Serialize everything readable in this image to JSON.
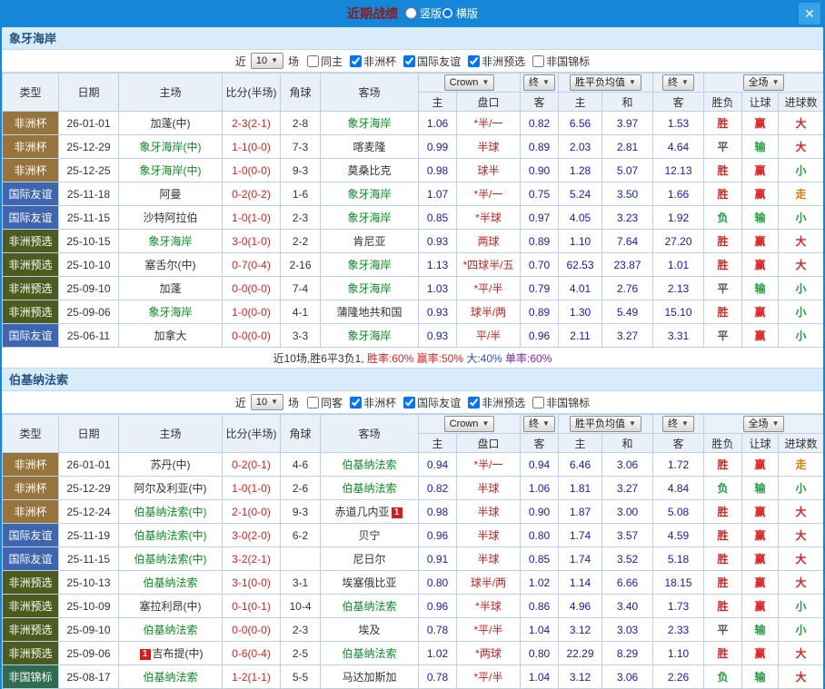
{
  "titlebar": {
    "title": "近期战绩",
    "layout_options": [
      {
        "label": "竖版",
        "selected": false
      },
      {
        "label": "横版",
        "selected": true
      }
    ],
    "close_label": "✕"
  },
  "columns": {
    "type": "类型",
    "date": "日期",
    "home": "主场",
    "score": "比分(半场)",
    "corner": "角球",
    "away": "客场",
    "odds_company": "Crown",
    "final1": "终",
    "wdl_avg": "胜平负均值",
    "final2": "终",
    "fulltime": "全场",
    "sub": [
      "主",
      "盘口",
      "客",
      "主",
      "和",
      "客",
      "胜负",
      "让球",
      "进球数"
    ]
  },
  "colors": {
    "type_非洲杯": "#96743C",
    "type_国际友谊": "#3E65B0",
    "type_非洲预选": "#4D5C1E",
    "type_非国锦标": "#2F6B50",
    "win": "#E02222",
    "draw": "#555555",
    "loss": "#1FA03C",
    "handicap_win": "#E02222",
    "handicap_loss": "#1FA03C",
    "push": "#E07A00",
    "big": "#E02222",
    "small": "#1FA03C",
    "focus_team": "#089020",
    "score": "#E02222",
    "odds": "#1717CE",
    "handicap": "#D02020",
    "avg": "#1717CE",
    "plain": "#333333"
  },
  "sections": [
    {
      "team": "象牙海岸",
      "filters": {
        "near": "近",
        "count": "10",
        "games": "场",
        "options": [
          {
            "label": "同主",
            "checked": false
          },
          {
            "label": "非洲杯",
            "checked": true
          },
          {
            "label": "国际友谊",
            "checked": true
          },
          {
            "label": "非洲预选",
            "checked": true
          },
          {
            "label": "非国锦标",
            "checked": false
          }
        ]
      },
      "rows": [
        {
          "type": "非洲杯",
          "date": "26-01-01",
          "home": "加蓬(中)",
          "home_focus": false,
          "score": "2-3(2-1)",
          "corner": "2-8",
          "away": "象牙海岸",
          "away_focus": true,
          "odds_home": "1.06",
          "handicap": "*半/一",
          "odds_away": "0.82",
          "avg_home": "6.56",
          "avg_draw": "3.97",
          "avg_away": "1.53",
          "result": "胜",
          "handicap_result": "赢",
          "goals": "大"
        },
        {
          "type": "非洲杯",
          "date": "25-12-29",
          "home": "象牙海岸(中)",
          "home_focus": true,
          "score": "1-1(0-0)",
          "corner": "7-3",
          "away": "喀麦隆",
          "away_focus": false,
          "odds_home": "0.99",
          "handicap": "半球",
          "odds_away": "0.89",
          "avg_home": "2.03",
          "avg_draw": "2.81",
          "avg_away": "4.64",
          "result": "平",
          "handicap_result": "输",
          "goals": "大"
        },
        {
          "type": "非洲杯",
          "date": "25-12-25",
          "home": "象牙海岸(中)",
          "home_focus": true,
          "score": "1-0(0-0)",
          "corner": "9-3",
          "away": "莫桑比克",
          "away_focus": false,
          "odds_home": "0.98",
          "handicap": "球半",
          "odds_away": "0.90",
          "avg_home": "1.28",
          "avg_draw": "5.07",
          "avg_away": "12.13",
          "result": "胜",
          "handicap_result": "赢",
          "goals": "小"
        },
        {
          "type": "国际友谊",
          "date": "25-11-18",
          "home": "阿曼",
          "home_focus": false,
          "score": "0-2(0-2)",
          "corner": "1-6",
          "away": "象牙海岸",
          "away_focus": true,
          "odds_home": "1.07",
          "handicap": "*半/一",
          "odds_away": "0.75",
          "avg_home": "5.24",
          "avg_draw": "3.50",
          "avg_away": "1.66",
          "result": "胜",
          "handicap_result": "赢",
          "goals": "走"
        },
        {
          "type": "国际友谊",
          "date": "25-11-15",
          "home": "沙特阿拉伯",
          "home_focus": false,
          "score": "1-0(1-0)",
          "corner": "2-3",
          "away": "象牙海岸",
          "away_focus": true,
          "odds_home": "0.85",
          "handicap": "*半球",
          "odds_away": "0.97",
          "avg_home": "4.05",
          "avg_draw": "3.23",
          "avg_away": "1.92",
          "result": "负",
          "handicap_result": "输",
          "goals": "小"
        },
        {
          "type": "非洲预选",
          "date": "25-10-15",
          "home": "象牙海岸",
          "home_focus": true,
          "score": "3-0(1-0)",
          "corner": "2-2",
          "away": "肯尼亚",
          "away_focus": false,
          "odds_home": "0.93",
          "handicap": "两球",
          "odds_away": "0.89",
          "avg_home": "1.10",
          "avg_draw": "7.64",
          "avg_away": "27.20",
          "result": "胜",
          "handicap_result": "赢",
          "goals": "大"
        },
        {
          "type": "非洲预选",
          "date": "25-10-10",
          "home": "塞舌尔(中)",
          "home_focus": false,
          "score": "0-7(0-4)",
          "corner": "2-16",
          "away": "象牙海岸",
          "away_focus": true,
          "odds_home": "1.13",
          "handicap": "*四球半/五",
          "odds_away": "0.70",
          "avg_home": "62.53",
          "avg_draw": "23.87",
          "avg_away": "1.01",
          "result": "胜",
          "handicap_result": "赢",
          "goals": "大"
        },
        {
          "type": "非洲预选",
          "date": "25-09-10",
          "home": "加蓬",
          "home_focus": false,
          "score": "0-0(0-0)",
          "corner": "7-4",
          "away": "象牙海岸",
          "away_focus": true,
          "odds_home": "1.03",
          "handicap": "*平/半",
          "odds_away": "0.79",
          "avg_home": "4.01",
          "avg_draw": "2.76",
          "avg_away": "2.13",
          "result": "平",
          "handicap_result": "输",
          "goals": "小"
        },
        {
          "type": "非洲预选",
          "date": "25-09-06",
          "home": "象牙海岸",
          "home_focus": true,
          "score": "1-0(0-0)",
          "corner": "4-1",
          "away": "蒲隆地共和国",
          "away_focus": false,
          "odds_home": "0.93",
          "handicap": "球半/两",
          "odds_away": "0.89",
          "avg_home": "1.30",
          "avg_draw": "5.49",
          "avg_away": "15.10",
          "result": "胜",
          "handicap_result": "赢",
          "goals": "小"
        },
        {
          "type": "国际友谊",
          "date": "25-06-11",
          "home": "加拿大",
          "home_focus": false,
          "score": "0-0(0-0)",
          "corner": "3-3",
          "away": "象牙海岸",
          "away_focus": true,
          "odds_home": "0.93",
          "handicap": "平/半",
          "odds_away": "0.96",
          "avg_home": "2.11",
          "avg_draw": "3.27",
          "avg_away": "3.31",
          "result": "平",
          "handicap_result": "赢",
          "goals": "小"
        }
      ],
      "summary": [
        {
          "text": "近10场,胜6平3负1, ",
          "color": "#333333"
        },
        {
          "text": "胜率:60% ",
          "color": "#E02222"
        },
        {
          "text": "赢率:50% ",
          "color": "#E02222"
        },
        {
          "text": "大:40% ",
          "color": "#2B52C0"
        },
        {
          "text": "单率:60%",
          "color": "#8A22AA"
        }
      ]
    },
    {
      "team": "伯基纳法索",
      "filters": {
        "near": "近",
        "count": "10",
        "games": "场",
        "options": [
          {
            "label": "同客",
            "checked": false
          },
          {
            "label": "非洲杯",
            "checked": true
          },
          {
            "label": "国际友谊",
            "checked": true
          },
          {
            "label": "非洲预选",
            "checked": true
          },
          {
            "label": "非国锦标",
            "checked": false
          }
        ]
      },
      "rows": [
        {
          "type": "非洲杯",
          "date": "26-01-01",
          "home": "苏丹(中)",
          "home_focus": false,
          "score": "0-2(0-1)",
          "corner": "4-6",
          "away": "伯基纳法索",
          "away_focus": true,
          "odds_home": "0.94",
          "handicap": "*半/一",
          "odds_away": "0.94",
          "avg_home": "6.46",
          "avg_draw": "3.06",
          "avg_away": "1.72",
          "result": "胜",
          "handicap_result": "赢",
          "goals": "走"
        },
        {
          "type": "非洲杯",
          "date": "25-12-29",
          "home": "阿尔及利亚(中)",
          "home_focus": false,
          "score": "1-0(1-0)",
          "corner": "2-6",
          "away": "伯基纳法索",
          "away_focus": true,
          "odds_home": "0.82",
          "handicap": "半球",
          "odds_away": "1.06",
          "avg_home": "1.81",
          "avg_draw": "3.27",
          "avg_away": "4.84",
          "result": "负",
          "handicap_result": "输",
          "goals": "小"
        },
        {
          "type": "非洲杯",
          "date": "25-12-24",
          "home": "伯基纳法索(中)",
          "home_focus": true,
          "score": "2-1(0-0)",
          "corner": "9-3",
          "away": "赤道几内亚",
          "away_focus": false,
          "away_badge": "1",
          "away_badge_pos": "right",
          "odds_home": "0.98",
          "handicap": "半球",
          "odds_away": "0.90",
          "avg_home": "1.87",
          "avg_draw": "3.00",
          "avg_away": "5.08",
          "result": "胜",
          "handicap_result": "赢",
          "goals": "大"
        },
        {
          "type": "国际友谊",
          "date": "25-11-19",
          "home": "伯基纳法索(中)",
          "home_focus": true,
          "score": "3-0(2-0)",
          "corner": "6-2",
          "away": "贝宁",
          "away_focus": false,
          "odds_home": "0.96",
          "handicap": "半球",
          "odds_away": "0.80",
          "avg_home": "1.74",
          "avg_draw": "3.57",
          "avg_away": "4.59",
          "result": "胜",
          "handicap_result": "赢",
          "goals": "大"
        },
        {
          "type": "国际友谊",
          "date": "25-11-15",
          "home": "伯基纳法索(中)",
          "home_focus": true,
          "score": "3-2(2-1)",
          "corner": "",
          "away": "尼日尔",
          "away_focus": false,
          "odds_home": "0.91",
          "handicap": "半球",
          "odds_away": "0.85",
          "avg_home": "1.74",
          "avg_draw": "3.52",
          "avg_away": "5.18",
          "result": "胜",
          "handicap_result": "赢",
          "goals": "大"
        },
        {
          "type": "非洲预选",
          "date": "25-10-13",
          "home": "伯基纳法索",
          "home_focus": true,
          "score": "3-1(0-0)",
          "corner": "3-1",
          "away": "埃塞俄比亚",
          "away_focus": false,
          "odds_home": "0.80",
          "handicap": "球半/两",
          "odds_away": "1.02",
          "avg_home": "1.14",
          "avg_draw": "6.66",
          "avg_away": "18.15",
          "result": "胜",
          "handicap_result": "赢",
          "goals": "大"
        },
        {
          "type": "非洲预选",
          "date": "25-10-09",
          "home": "塞拉利昂(中)",
          "home_focus": false,
          "score": "0-1(0-1)",
          "corner": "10-4",
          "away": "伯基纳法索",
          "away_focus": true,
          "odds_home": "0.96",
          "handicap": "*半球",
          "odds_away": "0.86",
          "avg_home": "4.96",
          "avg_draw": "3.40",
          "avg_away": "1.73",
          "result": "胜",
          "handicap_result": "赢",
          "goals": "小"
        },
        {
          "type": "非洲预选",
          "date": "25-09-10",
          "home": "伯基纳法索",
          "home_focus": true,
          "score": "0-0(0-0)",
          "corner": "2-3",
          "away": "埃及",
          "away_focus": false,
          "odds_home": "0.78",
          "handicap": "*平/半",
          "odds_away": "1.04",
          "avg_home": "3.12",
          "avg_draw": "3.03",
          "avg_away": "2.33",
          "result": "平",
          "handicap_result": "输",
          "goals": "小"
        },
        {
          "type": "非洲预选",
          "date": "25-09-06",
          "home": "吉布提(中)",
          "home_focus": false,
          "home_badge": "1",
          "home_badge_pos": "left",
          "score": "0-6(0-4)",
          "corner": "2-5",
          "away": "伯基纳法索",
          "away_focus": true,
          "odds_home": "1.02",
          "handicap": "*两球",
          "odds_away": "0.80",
          "avg_home": "22.29",
          "avg_draw": "8.29",
          "avg_away": "1.10",
          "result": "胜",
          "handicap_result": "赢",
          "goals": "大"
        },
        {
          "type": "非国锦标",
          "date": "25-08-17",
          "home": "伯基纳法索",
          "home_focus": true,
          "score": "1-2(1-1)",
          "corner": "5-5",
          "away": "马达加斯加",
          "away_focus": false,
          "odds_home": "0.78",
          "handicap": "*平/半",
          "odds_away": "1.04",
          "avg_home": "3.12",
          "avg_draw": "3.06",
          "avg_away": "2.26",
          "result": "负",
          "handicap_result": "输",
          "goals": "大"
        }
      ]
    }
  ]
}
